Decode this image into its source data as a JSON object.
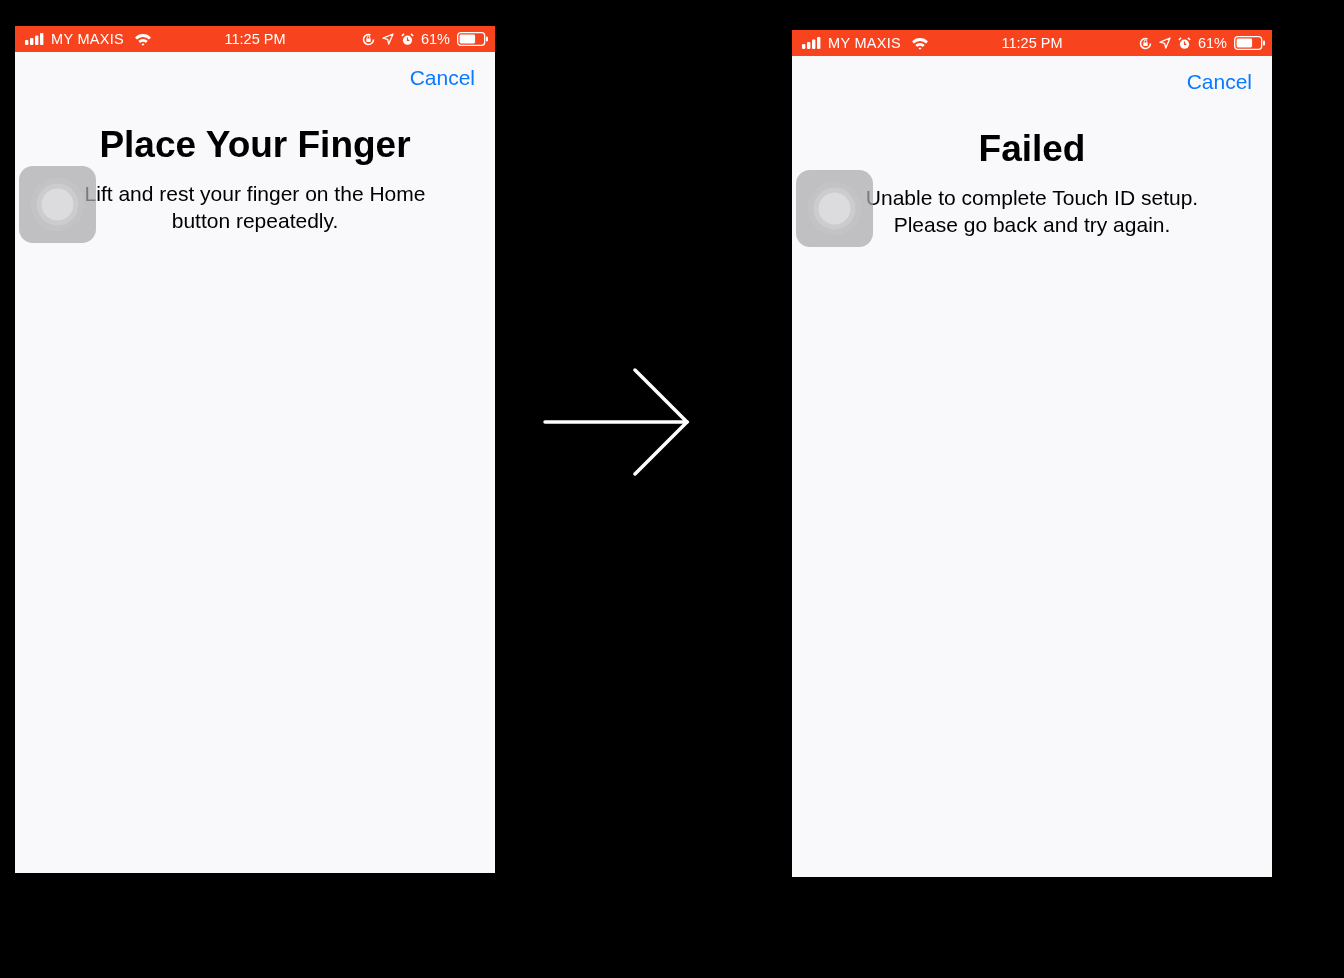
{
  "screens": [
    {
      "status_bar": {
        "carrier": "MY MAXIS",
        "time": "11:25 PM",
        "battery": "61%"
      },
      "cancel": "Cancel",
      "title": "Place Your Finger",
      "message": "Lift and rest your finger on the Home button repeatedly."
    },
    {
      "status_bar": {
        "carrier": "MY MAXIS",
        "time": "11:25 PM",
        "battery": "61%"
      },
      "cancel": "Cancel",
      "title": "Failed",
      "message": "Unable to complete Touch ID setup. Please go back and try again."
    }
  ]
}
